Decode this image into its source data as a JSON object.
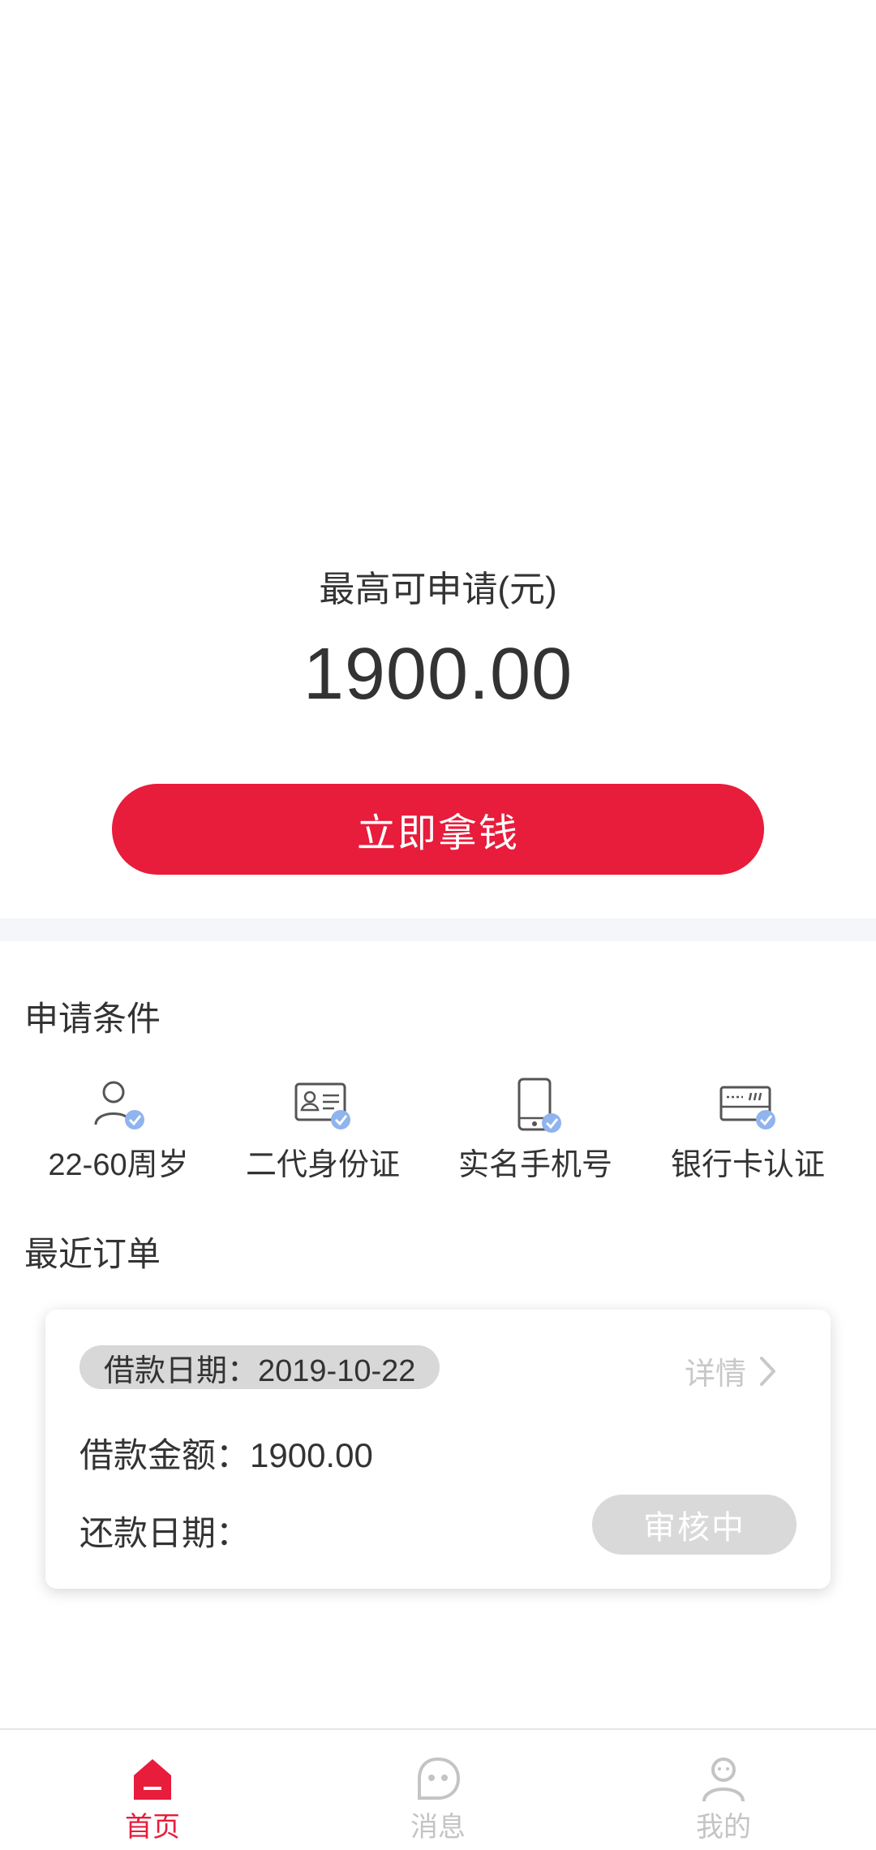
{
  "colors": {
    "accent": "#e81c3b",
    "badge": "#8fb4ee",
    "muted": "#c4c4c4",
    "pill": "#d8d8d8"
  },
  "hero": {
    "max_label": "最高可申请(元)",
    "max_amount": "1900.00",
    "cta_label": "立即拿钱"
  },
  "conditions": {
    "title": "申请条件",
    "items": [
      {
        "label": "22-60周岁",
        "icon": "person-check-icon"
      },
      {
        "label": "二代身份证",
        "icon": "id-card-check-icon"
      },
      {
        "label": "实名手机号",
        "icon": "phone-check-icon"
      },
      {
        "label": "银行卡认证",
        "icon": "bank-card-check-icon"
      }
    ]
  },
  "orders": {
    "title": "最近订单",
    "card": {
      "loan_date": "借款日期：2019-10-22",
      "detail_label": "详情",
      "loan_amount": "借款金额：1900.00",
      "repay_date": "还款日期：",
      "status": "审核中"
    }
  },
  "tabbar": {
    "items": [
      {
        "label": "首页",
        "icon": "home-icon",
        "active": true
      },
      {
        "label": "消息",
        "icon": "message-icon",
        "active": false
      },
      {
        "label": "我的",
        "icon": "profile-icon",
        "active": false
      }
    ]
  }
}
